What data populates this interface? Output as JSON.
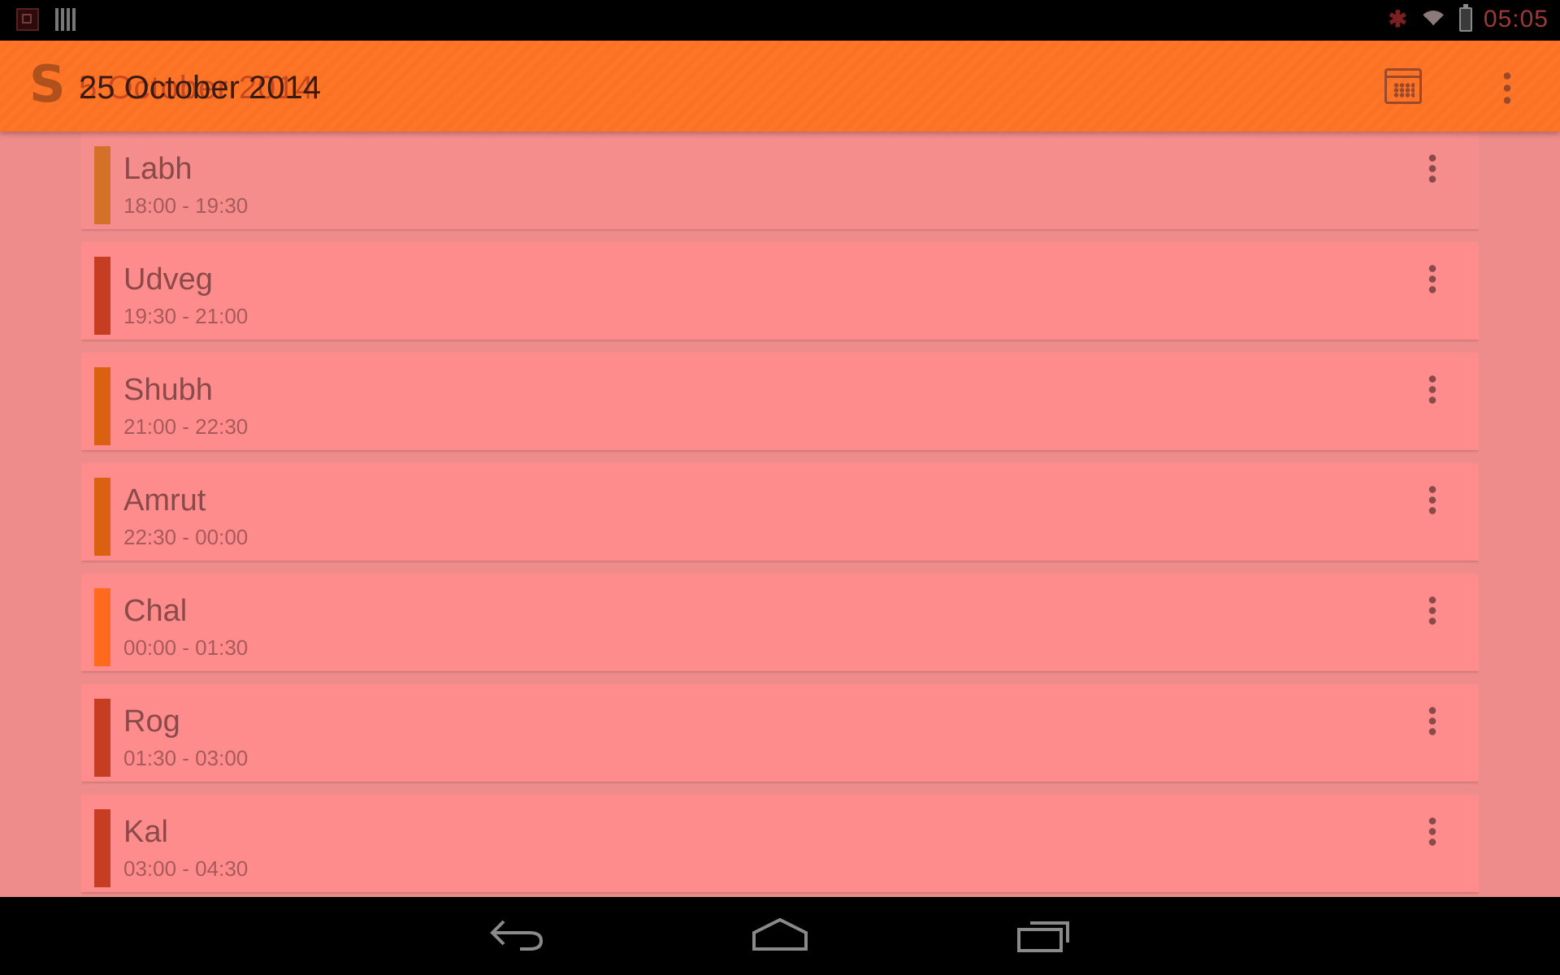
{
  "status_bar": {
    "clock": "05:05",
    "icons": [
      "screenshot-notification-icon",
      "barcode-notification-icon",
      "bluetooth-icon",
      "wifi-icon",
      "battery-icon"
    ]
  },
  "action_bar": {
    "app_logo": "S",
    "date_title": "25 October 2014",
    "date_title_ghost": "5 October 2014",
    "calendar_icon": "calendar-icon",
    "overflow_icon": "overflow-menu-icon",
    "accent_color": "#ff7324"
  },
  "choghadiya": [
    {
      "name": "Labh",
      "time": "18:00 - 19:30",
      "color": "#d4702a"
    },
    {
      "name": "Udveg",
      "time": "19:30 - 21:00",
      "color": "#c53e22"
    },
    {
      "name": "Shubh",
      "time": "21:00 - 22:30",
      "color": "#d9610f"
    },
    {
      "name": "Amrut",
      "time": "22:30 - 00:00",
      "color": "#d9610f"
    },
    {
      "name": "Chal",
      "time": "00:00 - 01:30",
      "color": "#ff6a1c"
    },
    {
      "name": "Rog",
      "time": "01:30 - 03:00",
      "color": "#c53e22"
    },
    {
      "name": "Kal",
      "time": "03:00 - 04:30",
      "color": "#c53e22"
    }
  ],
  "navigation": {
    "back_icon": "back-icon",
    "home_icon": "home-icon",
    "recents_icon": "recent-apps-icon"
  }
}
